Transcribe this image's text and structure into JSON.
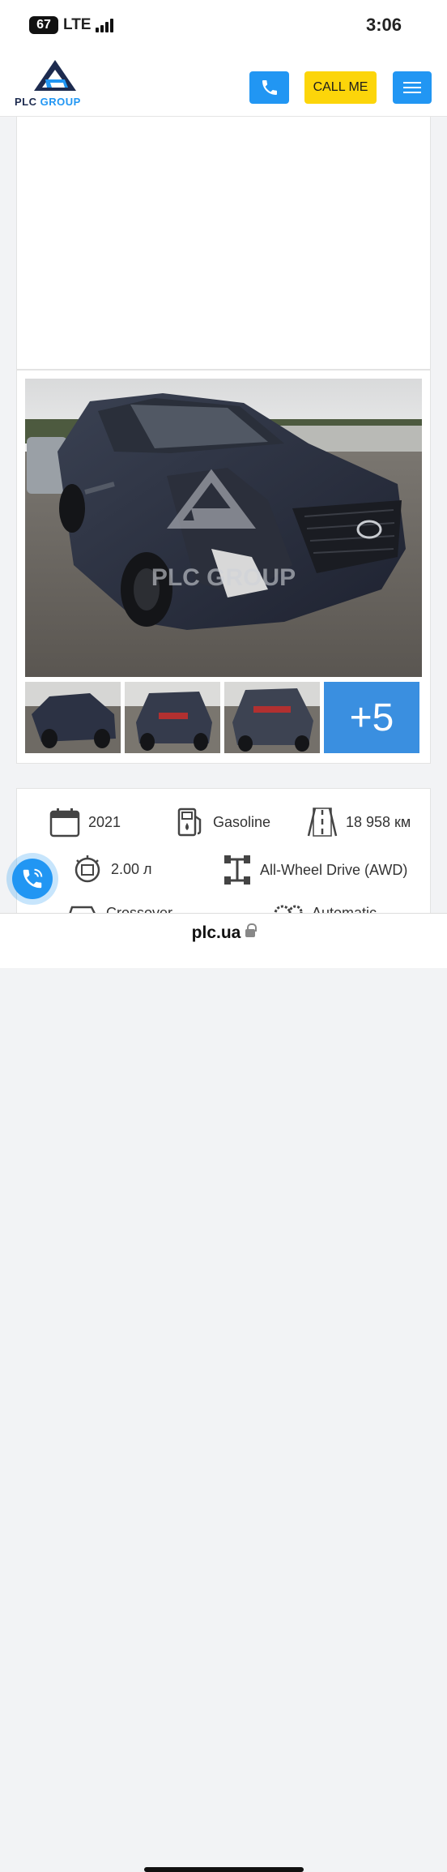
{
  "status_bar": {
    "battery": "67",
    "network": "LTE",
    "time": "3:06"
  },
  "header": {
    "logo_part1": "PLC",
    "logo_part2": "GROUP",
    "call_me_label": "CALL ME",
    "brand_colors": {
      "blue": "#2196f3",
      "yellow": "#fcd50a",
      "navy": "#1d2b4f"
    }
  },
  "gallery": {
    "watermark": "PLC GROUP",
    "more_count": "+5"
  },
  "specs": {
    "year": "2021",
    "fuel": "Gasoline",
    "mileage": "18 958 км",
    "engine": "2.00 л",
    "drive": "All-Wheel Drive (AWD)",
    "body": "Crossover",
    "transmission": "Automatic"
  },
  "browser": {
    "url": "plc.ua"
  }
}
